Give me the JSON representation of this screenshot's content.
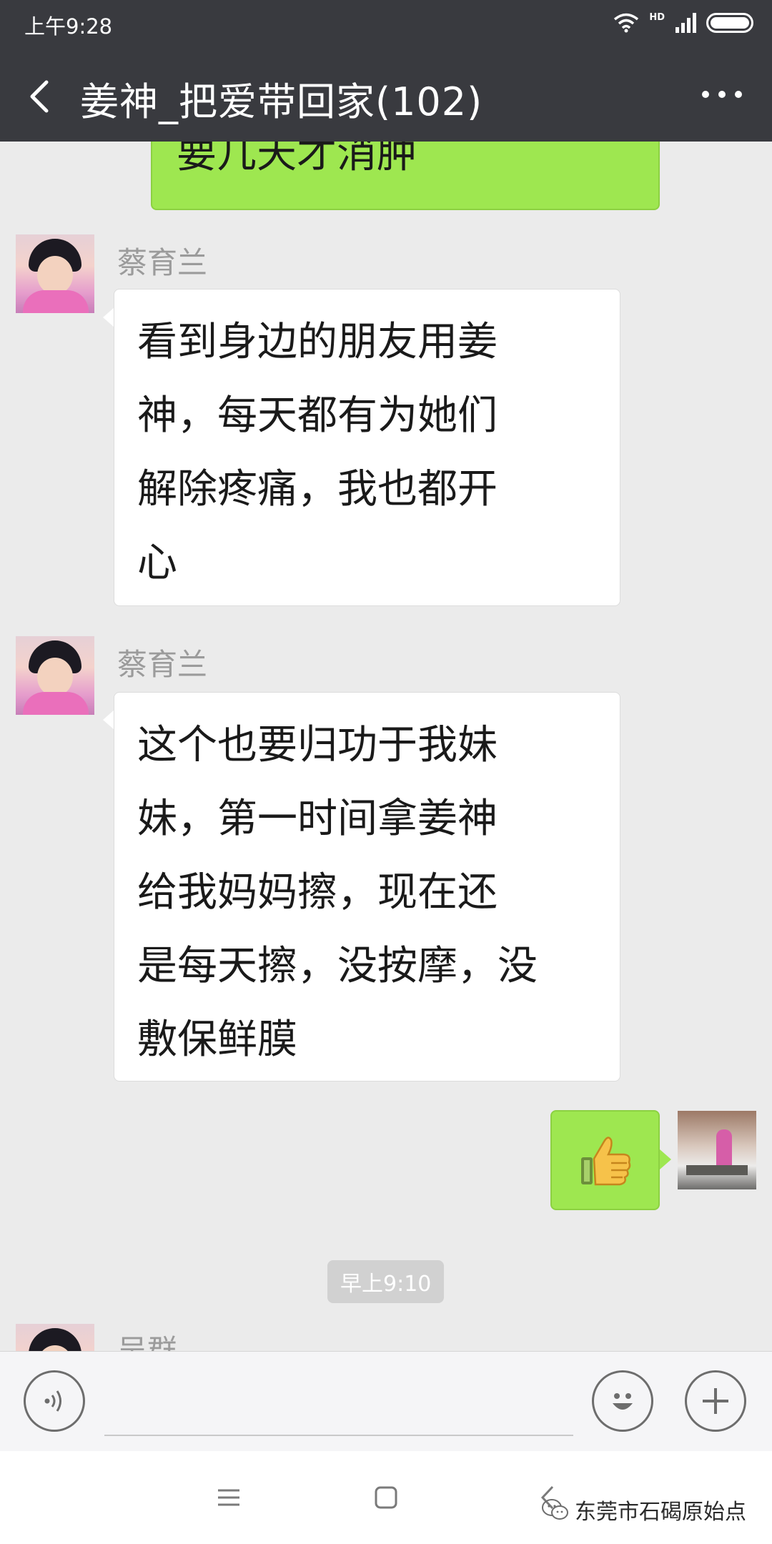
{
  "status_bar": {
    "time": "上午9:28",
    "network": "HD",
    "icons": [
      "wifi-icon",
      "signal-icon",
      "battery-icon"
    ]
  },
  "header": {
    "back_icon": "back-arrow-icon",
    "title": "姜神_把爱带回家(102)",
    "more_icon": "more-icon"
  },
  "messages": [
    {
      "side": "right",
      "type": "text",
      "text": "要几天才消肿"
    },
    {
      "side": "left",
      "sender": "蔡育兰",
      "type": "text",
      "text": "看到身边的朋友用姜\n神，每天都有为她们\n解除疼痛，我也都开\n心"
    },
    {
      "side": "left",
      "sender": "蔡育兰",
      "type": "text",
      "text": "这个也要归功于我妹\n妹，第一时间拿姜神\n给我妈妈擦，现在还\n是每天擦，没按摩，没\n敷保鲜膜"
    },
    {
      "side": "right",
      "type": "emoji",
      "emoji": "thumbs-up"
    },
    {
      "type": "time",
      "text": "早上9:10"
    },
    {
      "side": "left",
      "sender": "吴群",
      "type": "text",
      "text": ""
    }
  ],
  "input_bar": {
    "voice_icon": "voice-icon",
    "emoji_icon": "emoji-icon",
    "add_icon": "add-icon"
  },
  "nav_bar": {
    "menu_icon": "menu-icon",
    "home_icon": "home-icon",
    "back_icon": "back-nav-icon"
  },
  "watermark": {
    "text": "东莞市石碣原始点",
    "icon": "wechat-icon"
  },
  "colors": {
    "header_bg": "#393a3f",
    "chat_bg": "#ebebeb",
    "bubble_sent": "#9ee750",
    "bubble_received": "#ffffff",
    "sender_name": "#9b9b9b"
  }
}
